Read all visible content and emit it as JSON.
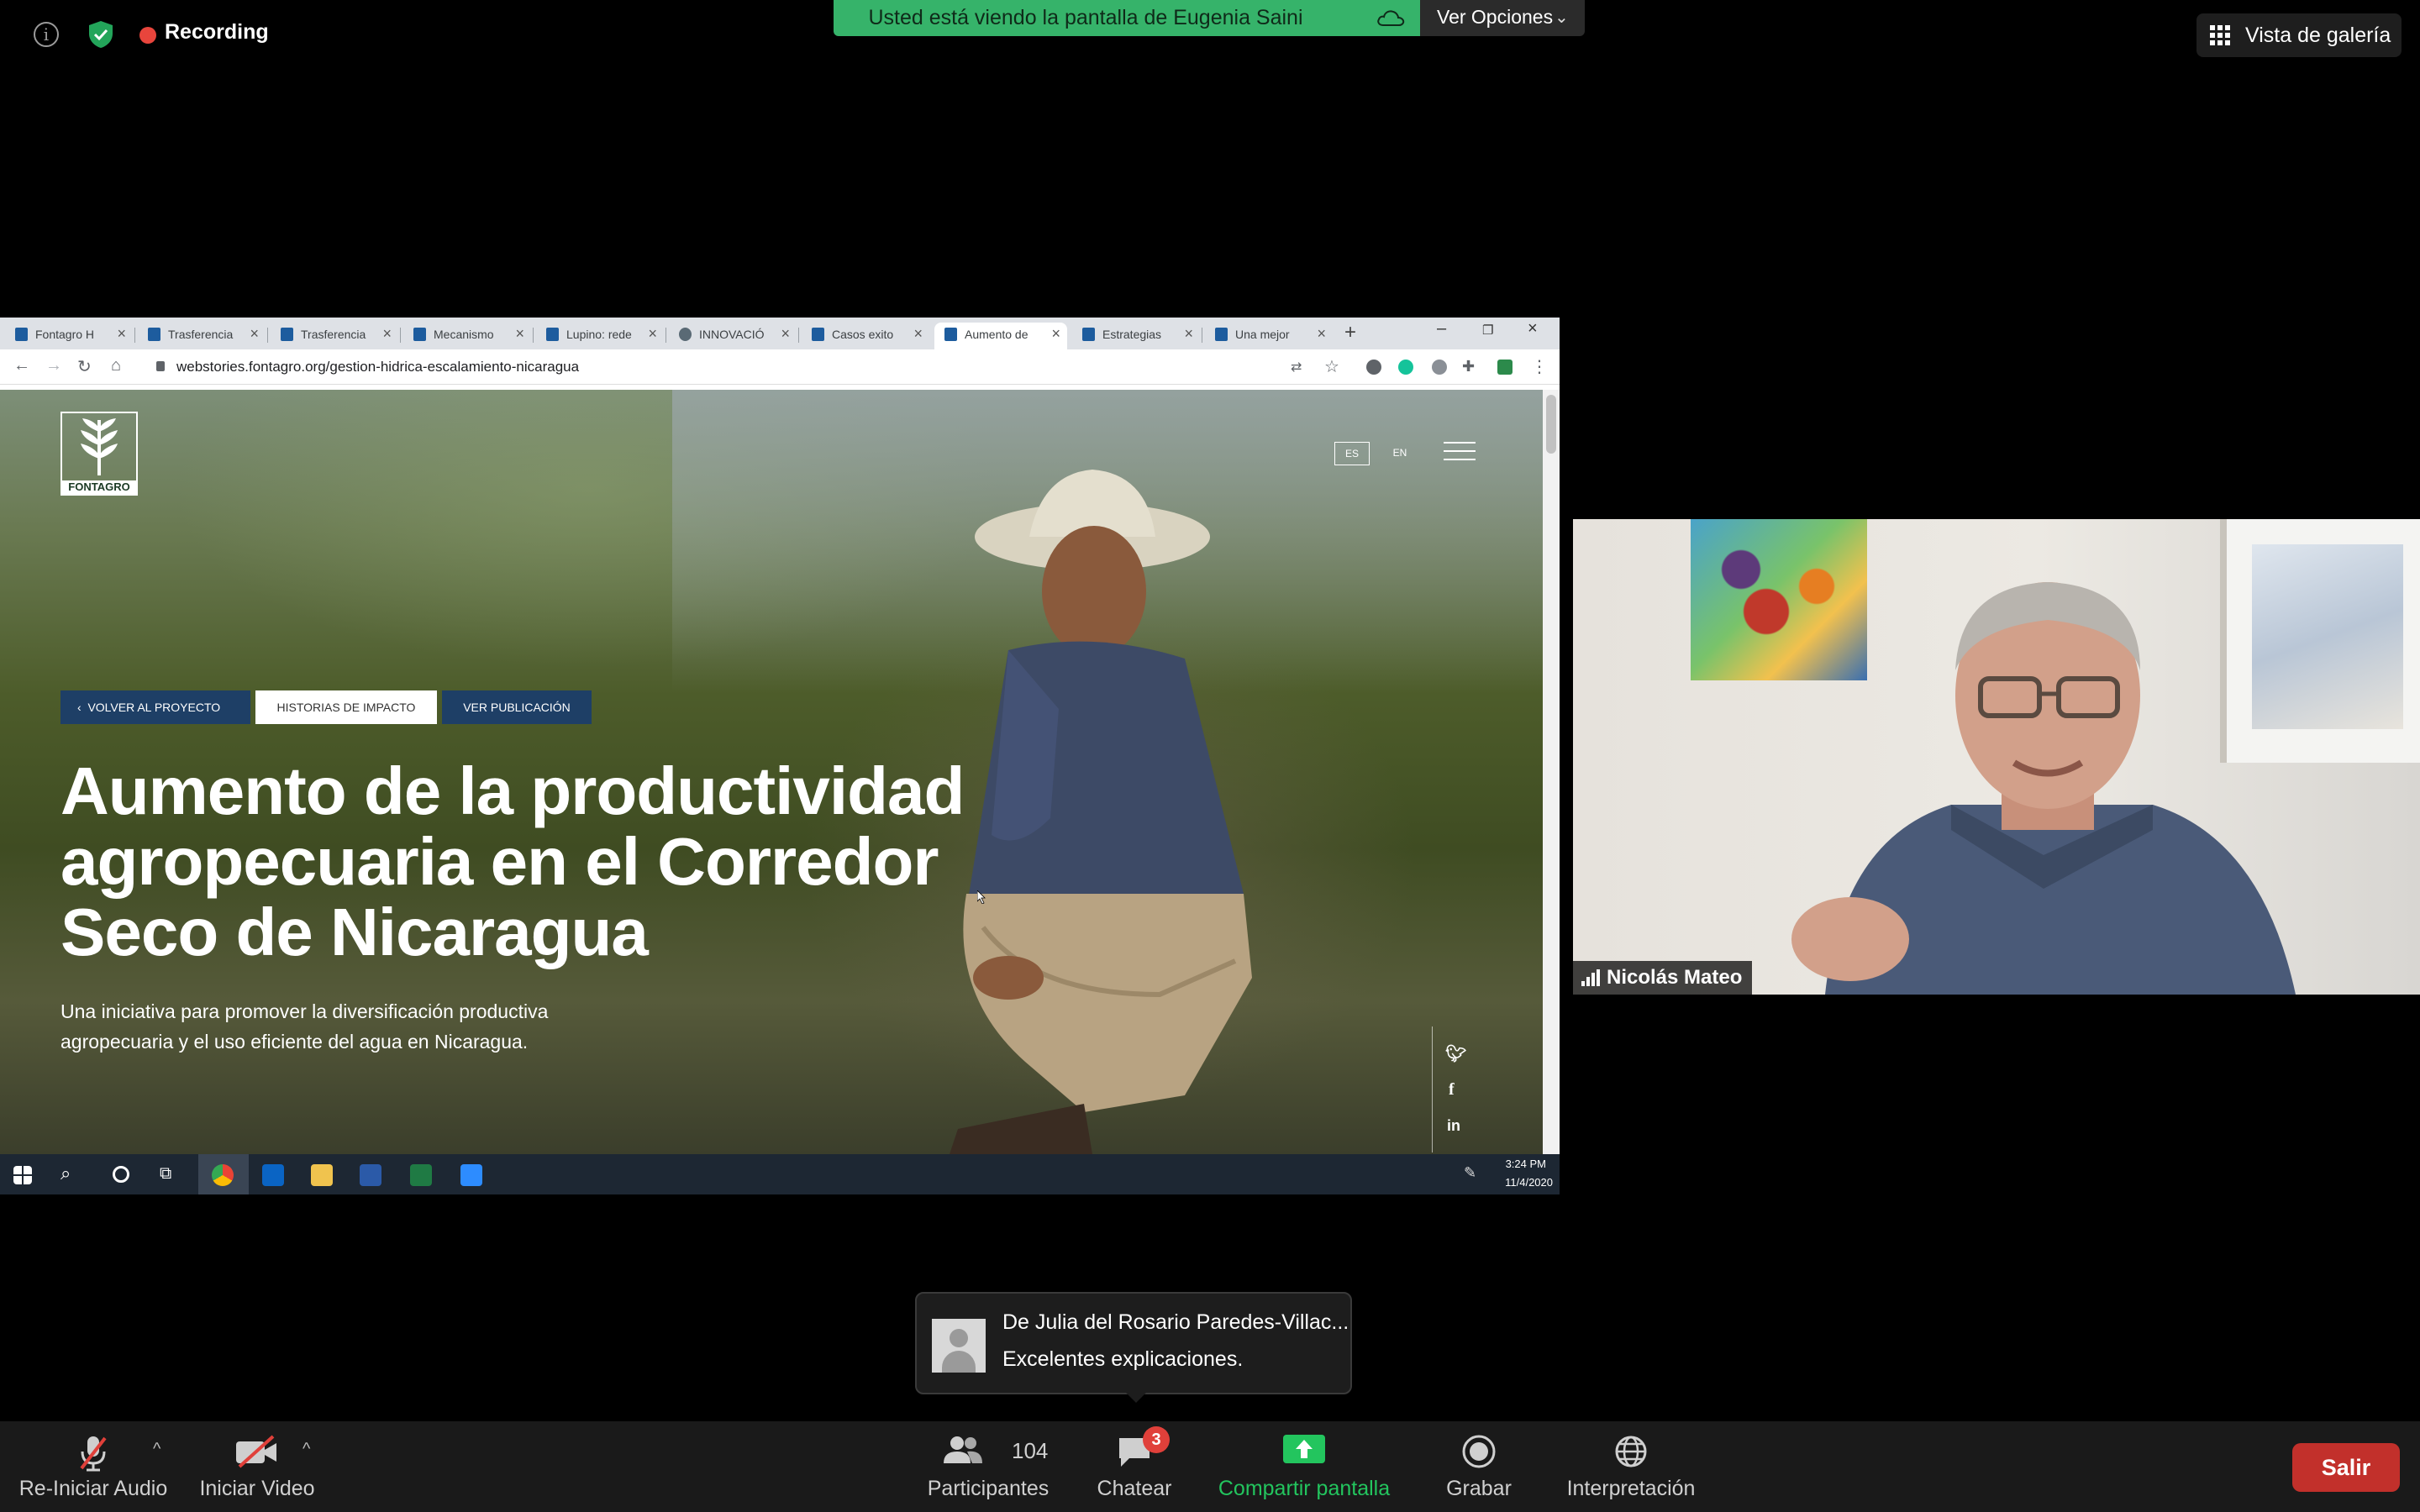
{
  "topbar": {
    "recording_label": "Recording",
    "share_banner": "Usted está viendo la pantalla de Eugenia Saini",
    "view_options": "Ver Opciones",
    "gallery_view": "Vista de galería"
  },
  "browser": {
    "tabs": [
      {
        "title": "Fontagro H"
      },
      {
        "title": "Trasferencia"
      },
      {
        "title": "Trasferencia"
      },
      {
        "title": "Mecanismo"
      },
      {
        "title": "Lupino: rede"
      },
      {
        "title": "INNOVACIÓ"
      },
      {
        "title": "Casos exito"
      },
      {
        "title": "Aumento de",
        "active": true
      },
      {
        "title": "Estrategias"
      },
      {
        "title": "Una mejor"
      }
    ],
    "url": "webstories.fontagro.org/gestion-hidrica-escalamiento-nicaragua"
  },
  "site": {
    "logo_text": "FONTAGRO",
    "lang_es": "ES",
    "lang_en": "EN",
    "btn_back": "VOLVER AL PROYECTO",
    "btn_stories": "HISTORIAS DE IMPACTO",
    "btn_publication": "VER PUBLICACIÓN",
    "hero_title": "Aumento de la productividad agropecuaria en el Corredor Seco de Nicaragua",
    "hero_subtitle": "Una iniciativa para promover la diversificación productiva agropecuaria y el uso eficiente del agua en Nicaragua."
  },
  "taskbar": {
    "time": "3:24 PM",
    "date": "11/4/2020"
  },
  "participant": {
    "name": "Nicolás Mateo"
  },
  "chat_toast": {
    "from": "De Julia del Rosario Paredes-Villac...",
    "message": "Excelentes explicaciones."
  },
  "toolbar": {
    "audio": "Re-Iniciar Audio",
    "video": "Iniciar Video",
    "participants": "Participantes",
    "participants_count": "104",
    "chat": "Chatear",
    "chat_badge": "3",
    "share": "Compartir pantalla",
    "record": "Grabar",
    "interpretation": "Interpretación",
    "leave": "Salir"
  },
  "colors": {
    "share_banner": "#36b36a",
    "leave_button": "#c2302b",
    "share_icon": "#23c55e",
    "recording_dot": "#e8453c"
  }
}
